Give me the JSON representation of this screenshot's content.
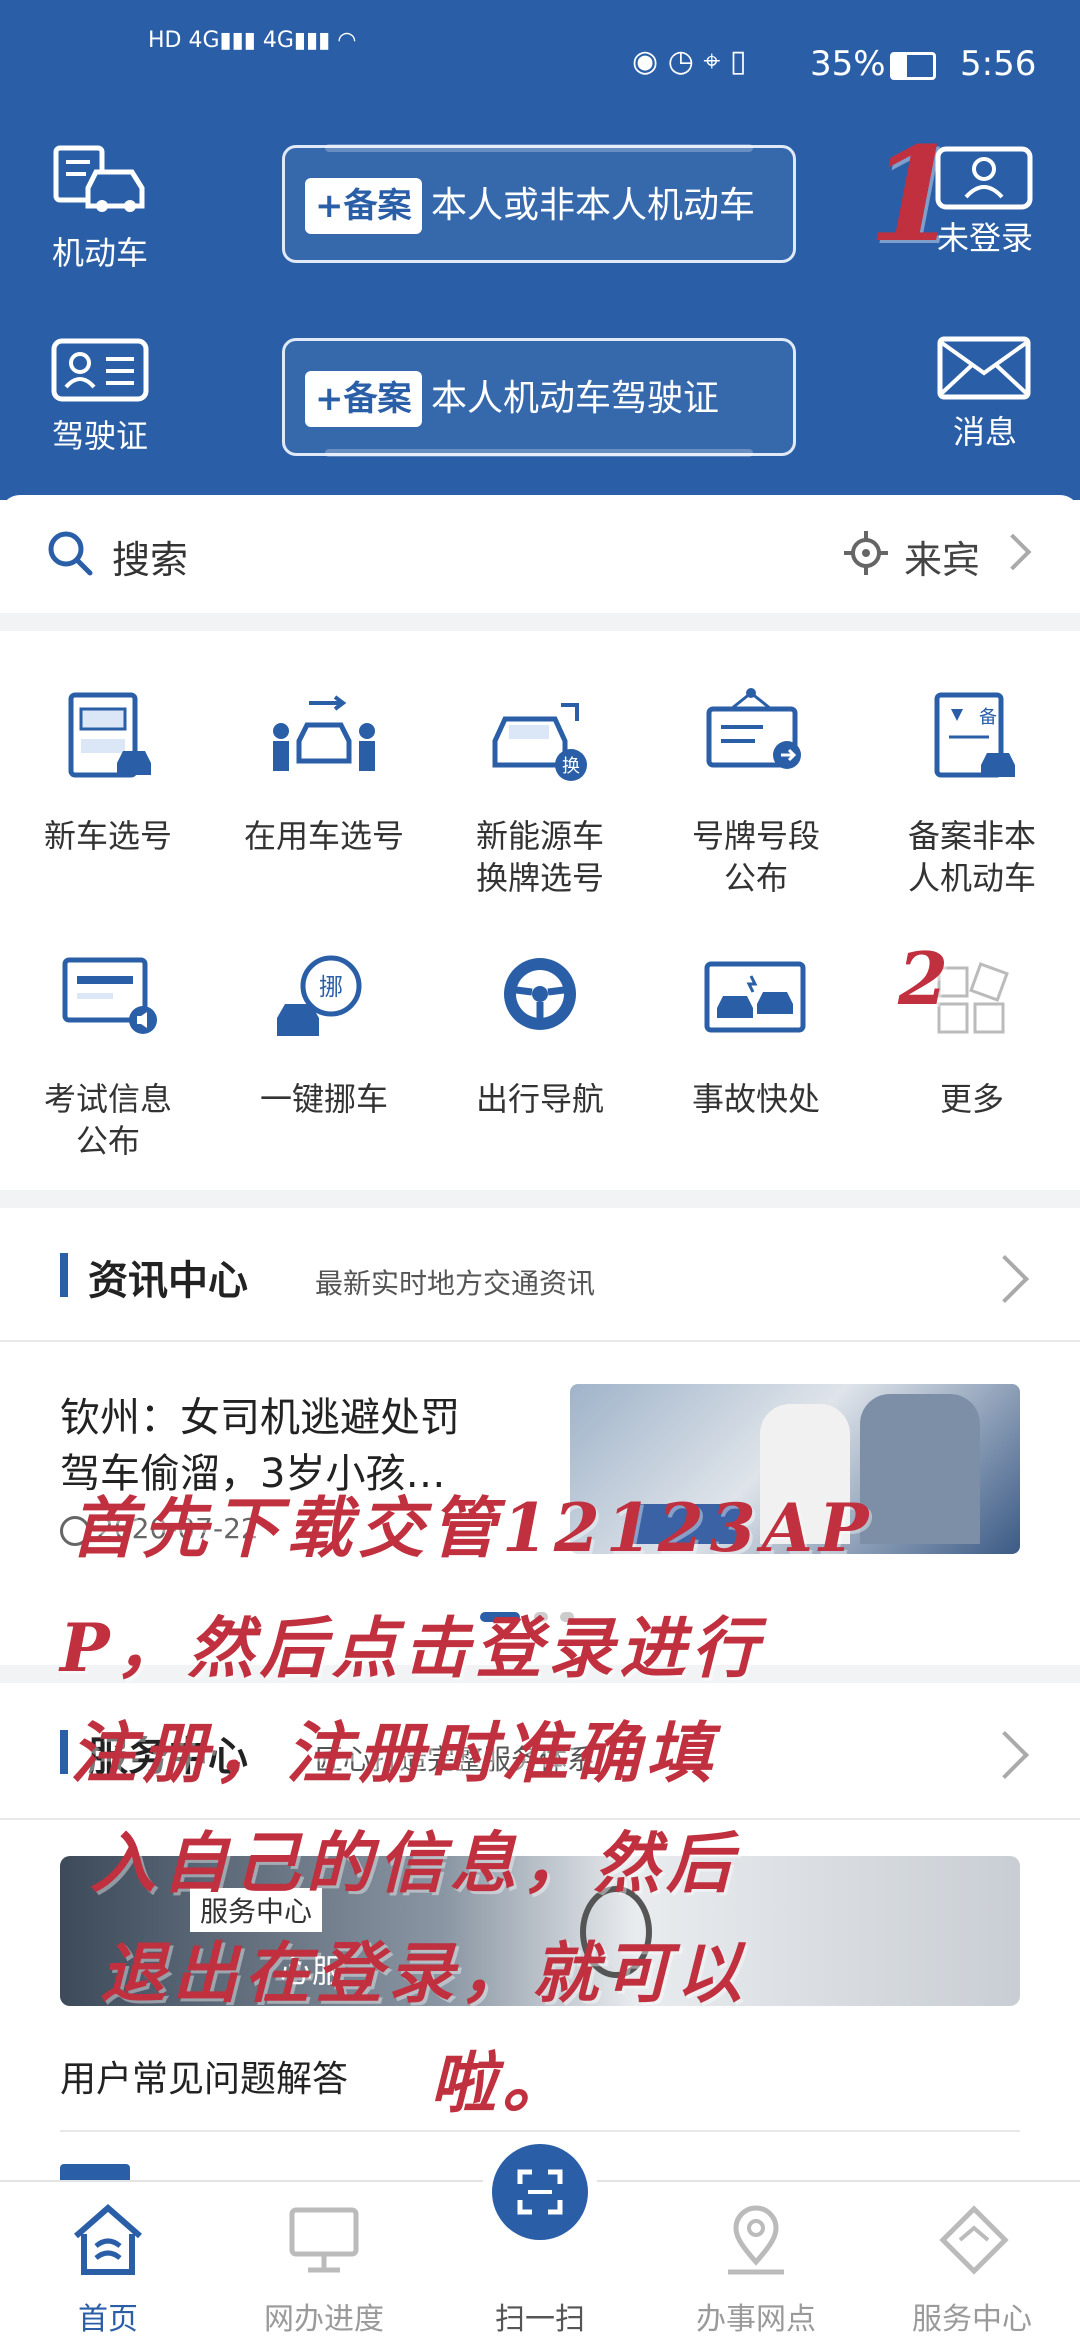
{
  "status_bar": {
    "time": "5:56",
    "battery": "35%"
  },
  "header": {
    "vehicle_label": "机动车",
    "license_label": "驾驶证",
    "login_label": "未登录",
    "message_label": "消息",
    "record_badge": "+备案",
    "record_vehicle_text": "本人或非本人机动车",
    "record_license_text": "本人机动车驾驶证"
  },
  "search": {
    "placeholder": "搜索",
    "location": "来宾"
  },
  "services": [
    {
      "label": "新车选号",
      "icon": "new-car-number-icon"
    },
    {
      "label": "在用车选号",
      "icon": "used-car-number-icon"
    },
    {
      "label": "新能源车换牌选号",
      "icon": "ev-plate-icon"
    },
    {
      "label": "号牌号段公布",
      "icon": "plate-segment-icon"
    },
    {
      "label": "备案非本人机动车",
      "icon": "record-vehicle-icon"
    },
    {
      "label": "考试信息公布",
      "icon": "exam-info-icon"
    },
    {
      "label": "一键挪车",
      "icon": "move-car-icon"
    },
    {
      "label": "出行导航",
      "icon": "navigation-icon"
    },
    {
      "label": "事故快处",
      "icon": "accident-icon"
    },
    {
      "label": "更多",
      "icon": "more-icon"
    }
  ],
  "news": {
    "title": "资讯中心",
    "subtitle": "最新实时地方交通资讯",
    "headline_line1": "钦州：女司机逃避处罚",
    "headline_line2": "驾车偷溜，3岁小孩…",
    "date": "2020-07-22"
  },
  "service_center": {
    "title": "服务中心",
    "subtitle": "匠心打造完整服务体系",
    "banner_tag": "服务中心",
    "banner_caption": "心服",
    "faq_label": "用户常见问题解答"
  },
  "annotations": {
    "marker1": "1",
    "marker2": "2",
    "line1": "首先下载交管12123AP",
    "line2": "P，然后点击登录进行",
    "line3": "注册，注册时准确填",
    "line4": "入自己的信息，然后",
    "line5": "退出在登录，就可以",
    "line6": "啦。"
  },
  "bottom_nav": {
    "home": "首页",
    "progress": "网办进度",
    "scan": "扫一扫",
    "outlets": "办事网点",
    "service_center": "服务中心"
  },
  "colors": {
    "primary": "#2a5fa7",
    "annotation": "#c0303e"
  }
}
